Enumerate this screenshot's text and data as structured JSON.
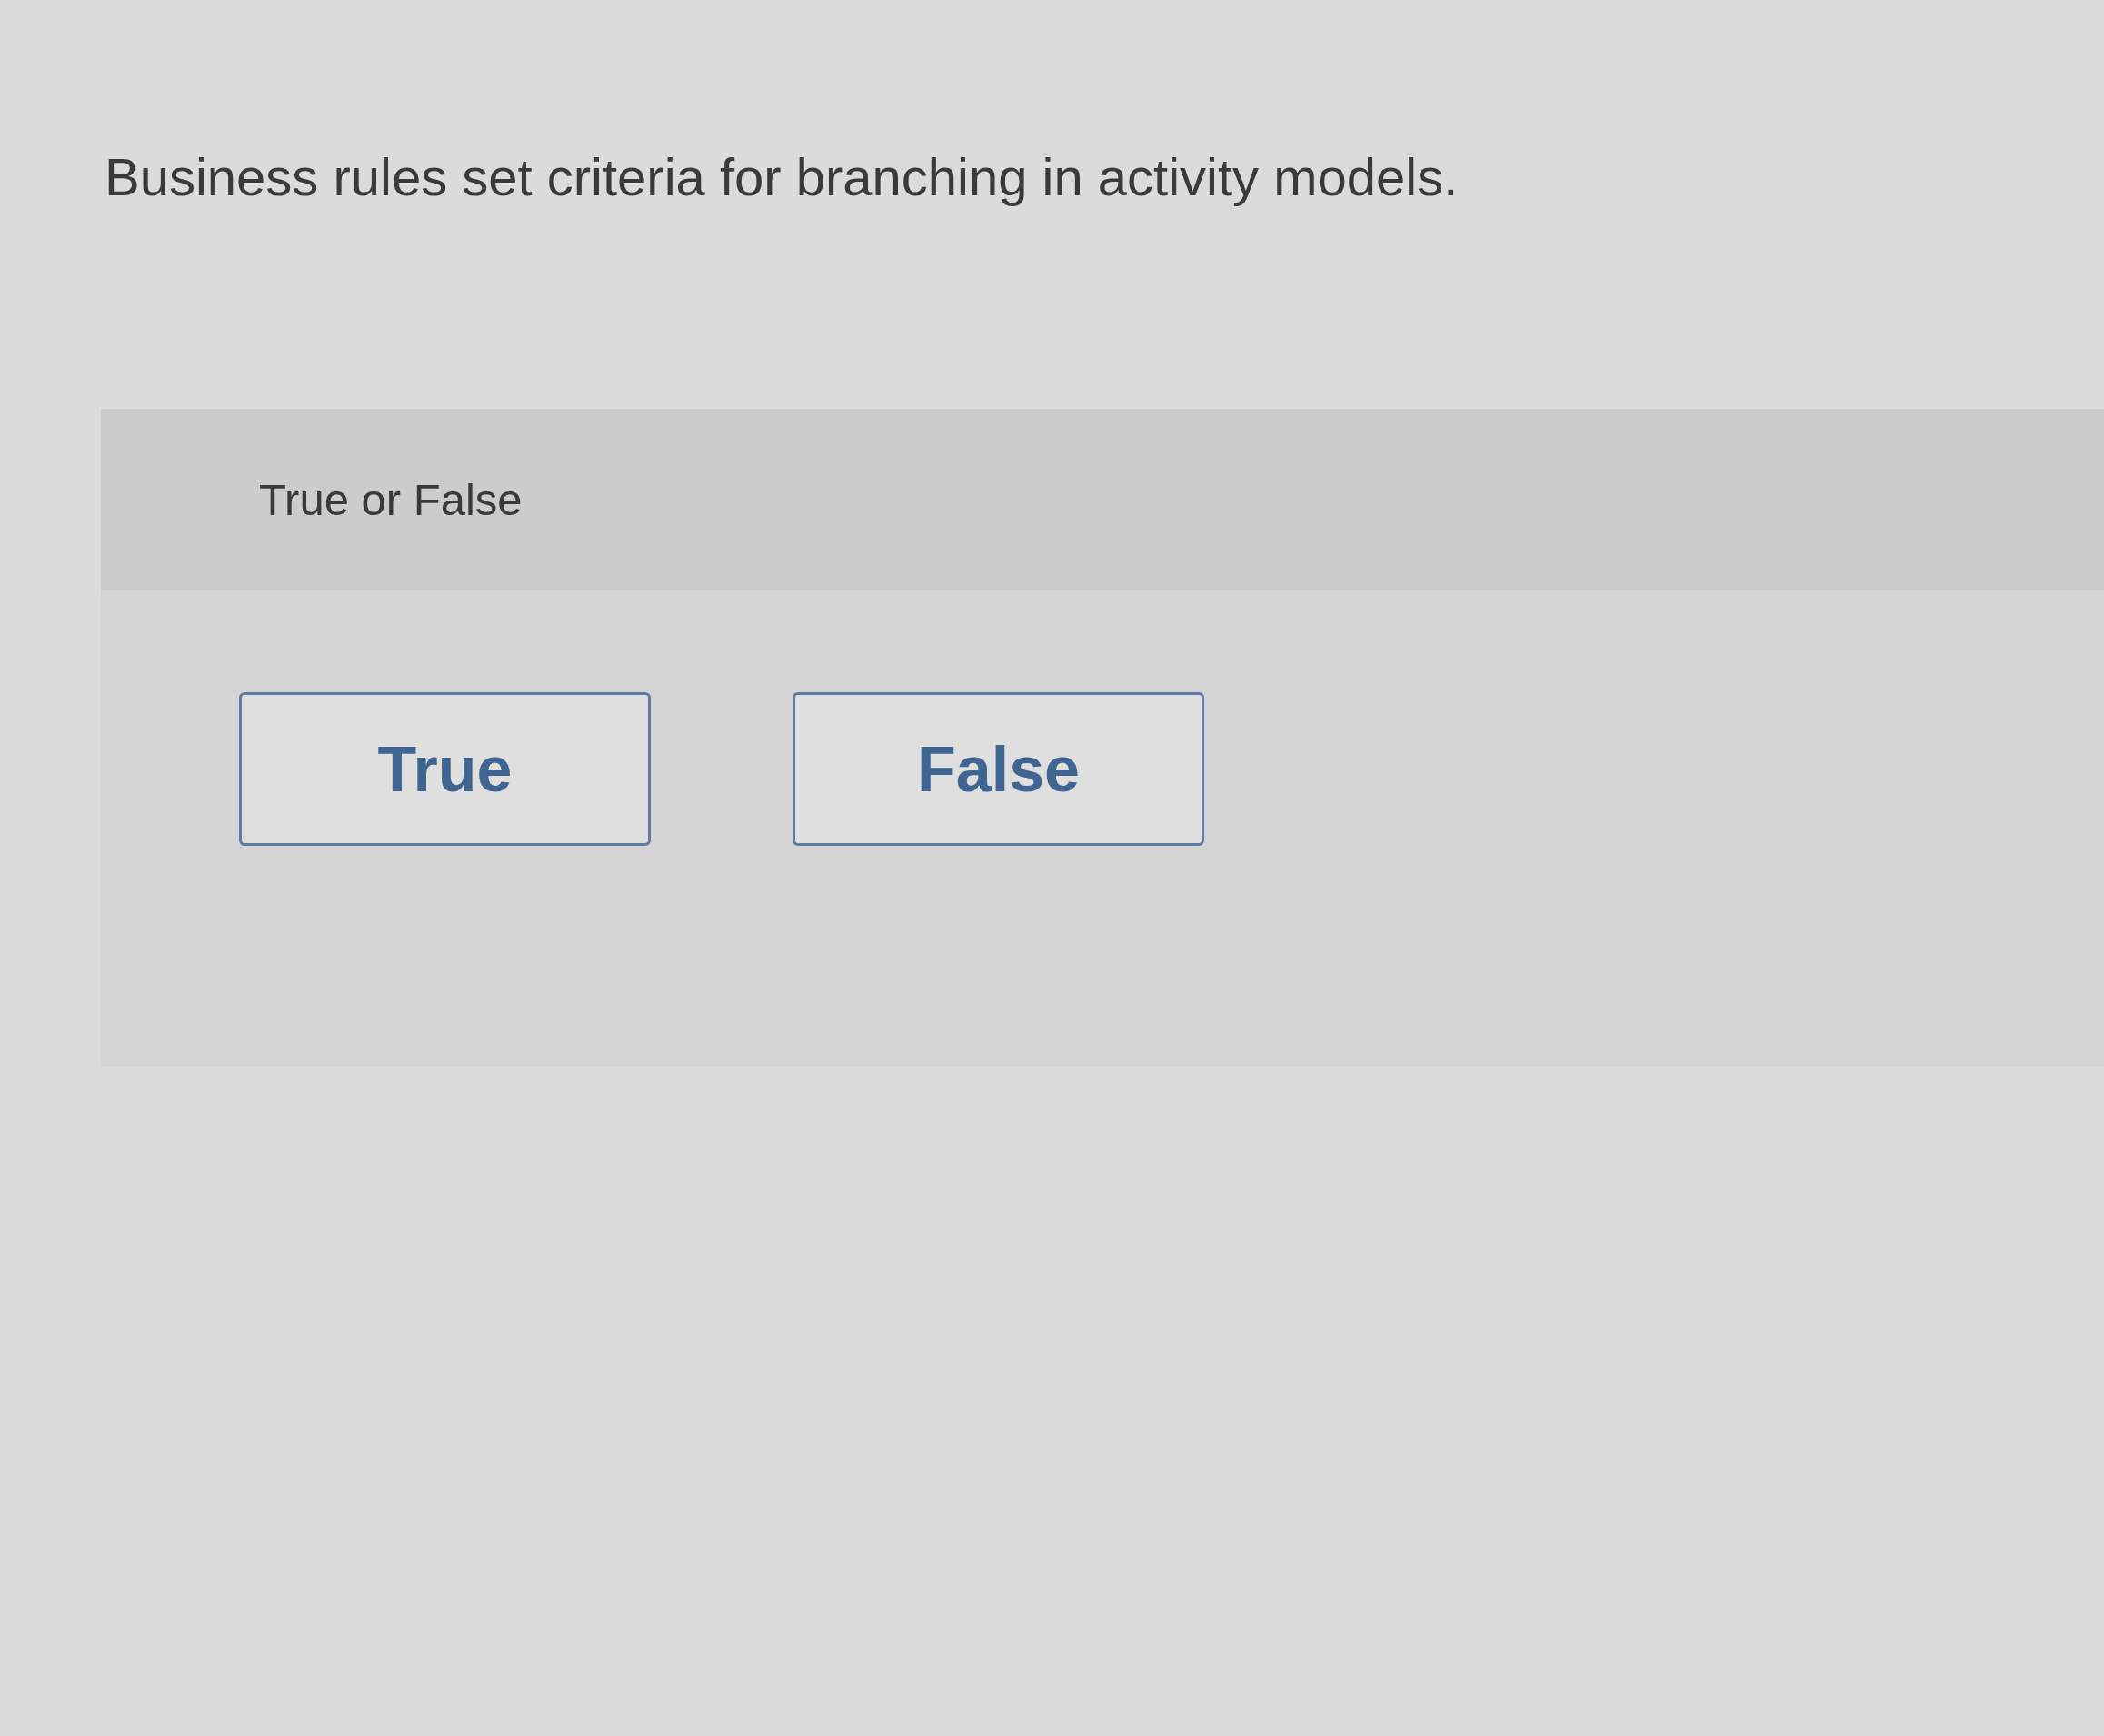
{
  "question": "Business rules set criteria for branching in activity models.",
  "prompt": "True or False",
  "options": [
    {
      "label": "True",
      "selected": false
    },
    {
      "label": "False",
      "selected": false
    }
  ]
}
